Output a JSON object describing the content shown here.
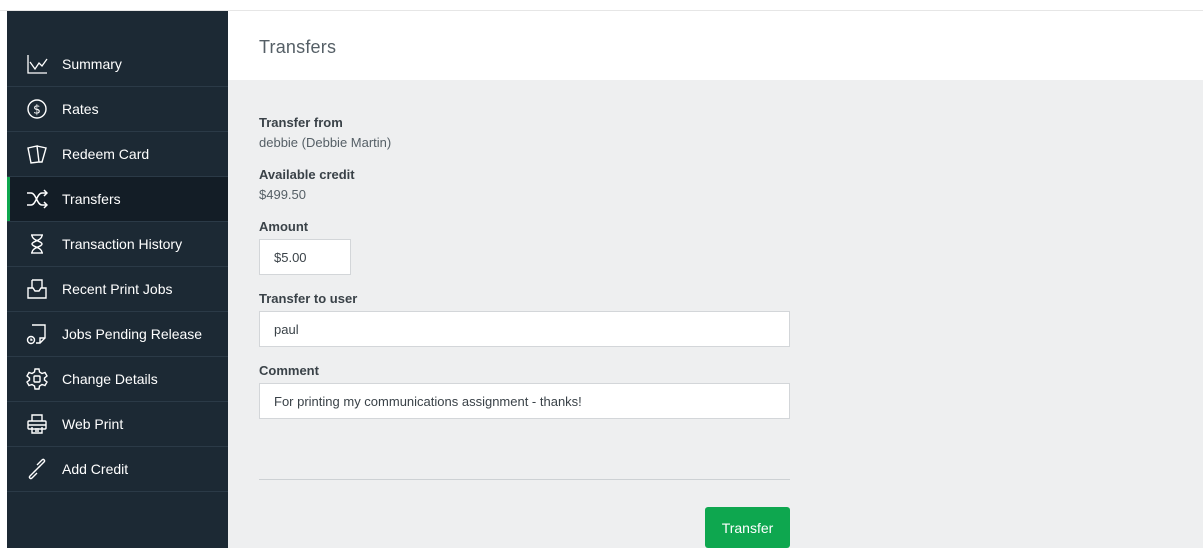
{
  "page": {
    "title": "Transfers"
  },
  "sidebar": {
    "items": [
      {
        "label": "Summary",
        "icon": "line-chart-icon",
        "active": false
      },
      {
        "label": "Rates",
        "icon": "dollar-circle-icon",
        "active": false
      },
      {
        "label": "Redeem Card",
        "icon": "cards-icon",
        "active": false
      },
      {
        "label": "Transfers",
        "icon": "shuffle-icon",
        "active": true
      },
      {
        "label": "Transaction History",
        "icon": "hourglass-icon",
        "active": false
      },
      {
        "label": "Recent Print Jobs",
        "icon": "printer-tray-icon",
        "active": false
      },
      {
        "label": "Jobs Pending Release",
        "icon": "pending-doc-icon",
        "active": false
      },
      {
        "label": "Change Details",
        "icon": "gear-icon",
        "active": false
      },
      {
        "label": "Web Print",
        "icon": "printer-icon",
        "active": false
      },
      {
        "label": "Add Credit",
        "icon": "link-icon",
        "active": false
      }
    ]
  },
  "form": {
    "transfer_from": {
      "label": "Transfer from",
      "value": "debbie (Debbie Martin)"
    },
    "available_credit": {
      "label": "Available credit",
      "value": "$499.50"
    },
    "amount": {
      "label": "Amount",
      "value": "$5.00"
    },
    "transfer_to": {
      "label": "Transfer to user",
      "value": "paul"
    },
    "comment": {
      "label": "Comment",
      "value": "For printing my communications assignment - thanks!"
    },
    "submit_label": "Transfer"
  },
  "colors": {
    "sidebar_bg": "#1c2934",
    "sidebar_active_bg": "#131d26",
    "accent": "#0ea74f",
    "content_bg": "#eeeff0"
  }
}
